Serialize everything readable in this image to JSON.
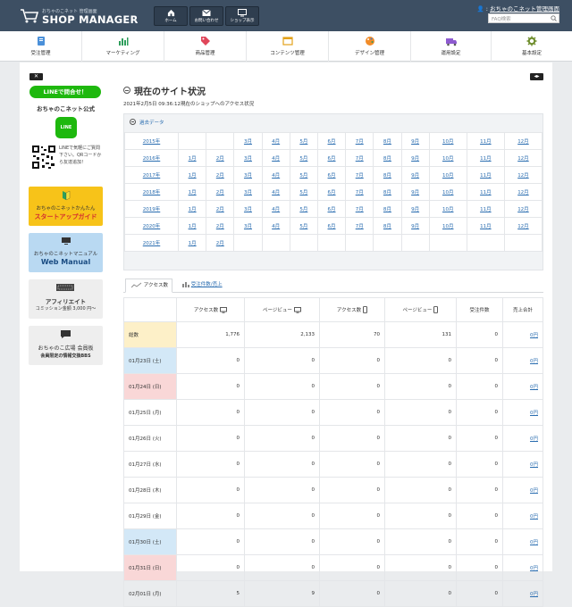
{
  "header": {
    "logo_sub": "おちゃのこネット 管理画面",
    "logo_main": "SHOP MANAGER",
    "buttons": [
      {
        "label": "ホーム",
        "icon": "home-icon"
      },
      {
        "label": "お問い合わせ",
        "icon": "mail-icon"
      },
      {
        "label": "ショップ表示",
        "icon": "monitor-icon"
      }
    ],
    "user_link": "おちゃのこネット管理画面",
    "faq_placeholder": "FAQ検索"
  },
  "nav": {
    "items": [
      {
        "label": "受注管理",
        "icon": "order-icon"
      },
      {
        "label": "マーケティング",
        "icon": "chart-icon"
      },
      {
        "label": "商品管理",
        "icon": "tag-icon"
      },
      {
        "label": "コンテンツ管理",
        "icon": "window-icon"
      },
      {
        "label": "デザイン管理",
        "icon": "palette-icon"
      },
      {
        "label": "運用設定",
        "icon": "truck-icon"
      },
      {
        "label": "基本設定",
        "icon": "gear-icon"
      }
    ]
  },
  "sidebar": {
    "close_left": "✕",
    "close_right": "◂▸",
    "line_badge": "LINEで問合せ！",
    "line_title": "おちゃのこネット公式",
    "line_icon": "LINE",
    "qr_text": "LINEで気軽にご質問下さい。QRコードから友達追加！",
    "banners": [
      {
        "l1": "おちゃのこネットかんたん",
        "l2": "スタートアップガイド",
        "bg": "#f7c319",
        "fg": "#d42f2f"
      },
      {
        "l1": "おちゃのこネットマニュアル",
        "l2": "Web Manual",
        "bg": "#b9d9f2",
        "fg": "#1a4c82"
      },
      {
        "l1": "アフィリエイト",
        "l2": "コミッション金額 3,000 円〜",
        "bg": "#eeeeee",
        "fg": "#333333"
      },
      {
        "l1": "おちゃのこ広場 会員板",
        "l2": "会員限定の情報交換BBS",
        "bg": "#eeeeee",
        "fg": "#333333"
      }
    ]
  },
  "main": {
    "title": "現在のサイト状況",
    "subtitle": "2021年2月5日 09:36:12現在のショップへのアクセス状況",
    "past_header": "過去データ",
    "years": [
      {
        "year": "2015年",
        "months": [
          "",
          "",
          "3月",
          "4月",
          "5月",
          "6月",
          "7月",
          "8月",
          "9月",
          "10月",
          "11月",
          "12月"
        ]
      },
      {
        "year": "2016年",
        "months": [
          "1月",
          "2月",
          "3月",
          "4月",
          "5月",
          "6月",
          "7月",
          "8月",
          "9月",
          "10月",
          "11月",
          "12月"
        ]
      },
      {
        "year": "2017年",
        "months": [
          "1月",
          "2月",
          "3月",
          "4月",
          "5月",
          "6月",
          "7月",
          "8月",
          "9月",
          "10月",
          "11月",
          "12月"
        ]
      },
      {
        "year": "2018年",
        "months": [
          "1月",
          "2月",
          "3月",
          "4月",
          "5月",
          "6月",
          "7月",
          "8月",
          "9月",
          "10月",
          "11月",
          "12月"
        ]
      },
      {
        "year": "2019年",
        "months": [
          "1月",
          "2月",
          "3月",
          "4月",
          "5月",
          "6月",
          "7月",
          "8月",
          "9月",
          "10月",
          "11月",
          "12月"
        ]
      },
      {
        "year": "2020年",
        "months": [
          "1月",
          "2月",
          "3月",
          "4月",
          "5月",
          "6月",
          "7月",
          "8月",
          "9月",
          "10月",
          "11月",
          "12月"
        ]
      },
      {
        "year": "2021年",
        "months": [
          "1月",
          "2月",
          "",
          "",
          "",
          "",
          "",
          "",
          "",
          "",
          "",
          ""
        ]
      }
    ],
    "tabs": [
      "アクセス数",
      "受注件数/売上"
    ],
    "columns": [
      "アクセス数",
      "ページビュー",
      "アクセス数",
      "ページビュー",
      "受注件数",
      "売上合計"
    ],
    "rows": [
      {
        "date": "総数",
        "kind": "total",
        "v": [
          "1,776",
          "2,133",
          "70",
          "131",
          "0",
          "0円"
        ]
      },
      {
        "date": "01月23日 (土)",
        "kind": "sat",
        "v": [
          "0",
          "0",
          "0",
          "0",
          "0",
          "0円"
        ]
      },
      {
        "date": "01月24日 (日)",
        "kind": "sun",
        "v": [
          "0",
          "0",
          "0",
          "0",
          "0",
          "0円"
        ]
      },
      {
        "date": "01月25日 (月)",
        "kind": "",
        "v": [
          "0",
          "0",
          "0",
          "0",
          "0",
          "0円"
        ]
      },
      {
        "date": "01月26日 (火)",
        "kind": "",
        "v": [
          "0",
          "0",
          "0",
          "0",
          "0",
          "0円"
        ]
      },
      {
        "date": "01月27日 (水)",
        "kind": "",
        "v": [
          "0",
          "0",
          "0",
          "0",
          "0",
          "0円"
        ]
      },
      {
        "date": "01月28日 (木)",
        "kind": "",
        "v": [
          "0",
          "0",
          "0",
          "0",
          "0",
          "0円"
        ]
      },
      {
        "date": "01月29日 (金)",
        "kind": "",
        "v": [
          "0",
          "0",
          "0",
          "0",
          "0",
          "0円"
        ]
      },
      {
        "date": "01月30日 (土)",
        "kind": "sat",
        "v": [
          "0",
          "0",
          "0",
          "0",
          "0",
          "0円"
        ]
      },
      {
        "date": "01月31日 (日)",
        "kind": "sun",
        "v": [
          "0",
          "0",
          "0",
          "0",
          "0",
          "0円"
        ]
      },
      {
        "date": "02月01日 (月)",
        "kind": "",
        "v": [
          "5",
          "9",
          "0",
          "0",
          "0",
          "0円"
        ]
      }
    ]
  }
}
